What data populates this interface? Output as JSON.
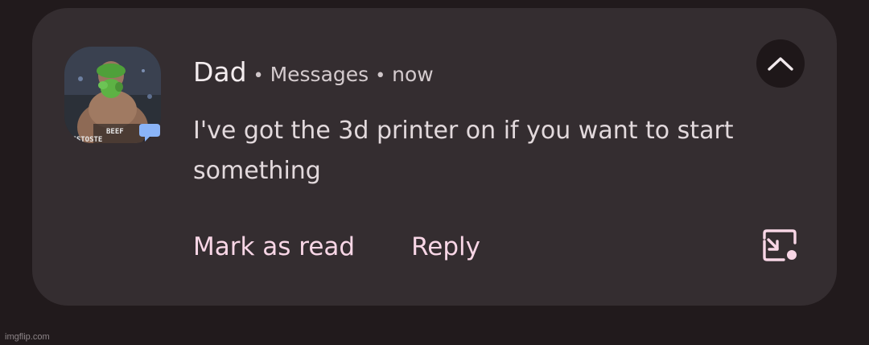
{
  "notification": {
    "sender": "Dad",
    "separator": "•",
    "app_name": "Messages",
    "time": "now",
    "message": "I've got the 3d printer on if you want to start something",
    "avatar_caption_line1": "BEEF",
    "avatar_caption_line2": "TESTOSTE",
    "app_badge_icon": "messages-bubble-icon",
    "collapse_icon": "chevron-up-icon",
    "popout_icon": "open-in-popup-icon"
  },
  "actions": {
    "mark_as_read": "Mark as read",
    "reply": "Reply"
  },
  "colors": {
    "background": "#211a1c",
    "card": "#342d30",
    "action_text": "#f8d6e6",
    "badge": "#8ab4f8"
  },
  "watermark": "imgflip.com"
}
